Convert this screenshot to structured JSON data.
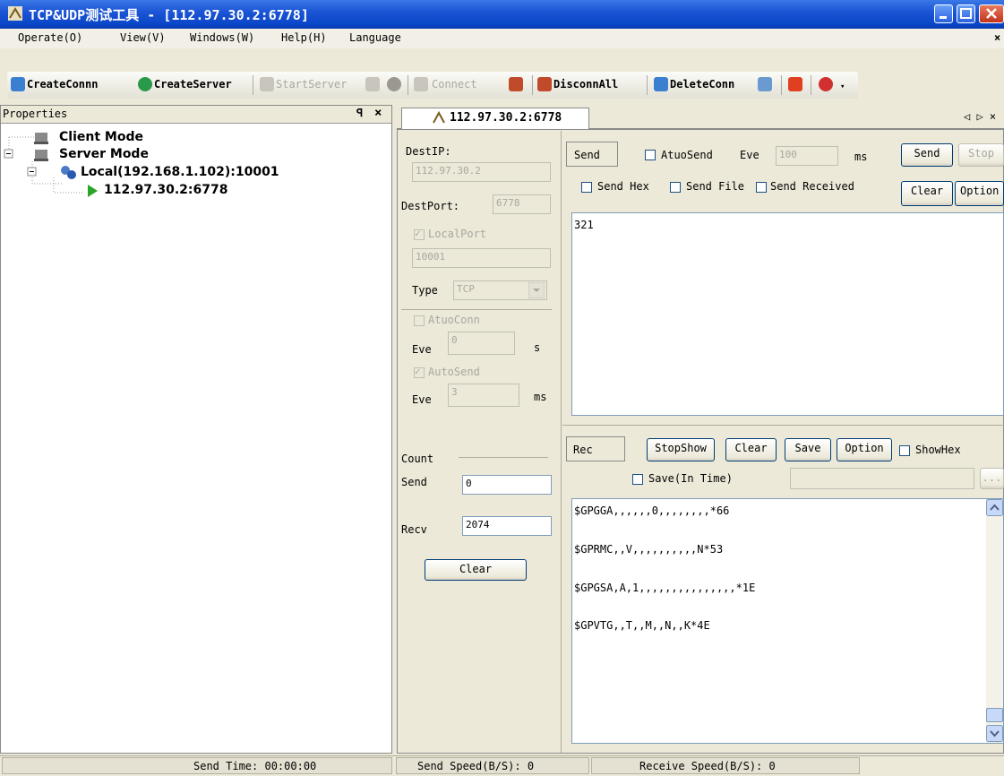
{
  "window": {
    "title": "TCP&UDP测试工具 - [112.97.30.2:6778]"
  },
  "menu": [
    "Operate(O)",
    "View(V)",
    "Windows(W)",
    "Help(H)",
    "Language"
  ],
  "menu_close": "×",
  "toolbar": {
    "create_conn": "CreateConnn",
    "create_server": "CreateServer",
    "start_server": "StartServer",
    "connect": "Connect",
    "disconn_all": "DisconnAll",
    "delete_conn": "DeleteConn"
  },
  "properties": {
    "title": "Properties",
    "pin": "ꟼ",
    "close": "×",
    "tree": {
      "client_mode": "Client Mode",
      "server_mode": "Server Mode",
      "local": "Local(192.168.1.102):10001",
      "connection": "112.97.30.2:6778"
    }
  },
  "tab": {
    "label": "112.97.30.2:6778",
    "nav": "◁ ▷ ×"
  },
  "settings": {
    "dest_ip_label": "DestIP:",
    "dest_ip": "112.97.30.2",
    "dest_port_label": "DestPort:",
    "dest_port": "6778",
    "local_port_label": "LocalPort",
    "local_port": "10001",
    "type_label": "Type",
    "type_value": "TCP",
    "atuo_conn_label": "AtuoConn",
    "eve_label": "Eve",
    "eve_conn": "0",
    "eve_conn_unit": "s",
    "auto_send_label": "AutoSend",
    "eve_send": "3",
    "eve_send_unit": "ms"
  },
  "count": {
    "title": "Count",
    "send_label": "Send",
    "send_value": "0",
    "recv_label": "Recv",
    "recv_value": "2074",
    "clear_label": "Clear"
  },
  "send_panel": {
    "send_title": "Send",
    "atuo_send_label": "AtuoSend",
    "eve_label": "Eve",
    "interval": "100",
    "unit": "ms",
    "send_button": "Send",
    "stop_button": "Stop",
    "send_hex": "Send Hex",
    "send_file": "Send File",
    "send_received": "Send Received",
    "clear_button": "Clear",
    "option_button": "Option",
    "content": "321"
  },
  "rec_panel": {
    "rec_title": "Rec",
    "stop_show": "StopShow",
    "clear": "Clear",
    "save": "Save",
    "option": "Option",
    "show_hex": "ShowHex",
    "save_in_time": "Save(In Time)",
    "browse": "...",
    "lines": [
      "$GPGGA,,,,,,0,,,,,,,,*66",
      "$GPRMC,,V,,,,,,,,,,N*53",
      "$GPGSA,A,1,,,,,,,,,,,,,,,*1E",
      "$GPVTG,,T,,M,,N,,K*4E"
    ]
  },
  "status": {
    "send_time": "Send Time: 00:00:00",
    "send_speed": "Send Speed(B/S): 0",
    "receive_speed": "Receive Speed(B/S): 0"
  },
  "colors": {
    "titlebar": "#1c55d6",
    "selected_arrow": "#2aa52a"
  }
}
